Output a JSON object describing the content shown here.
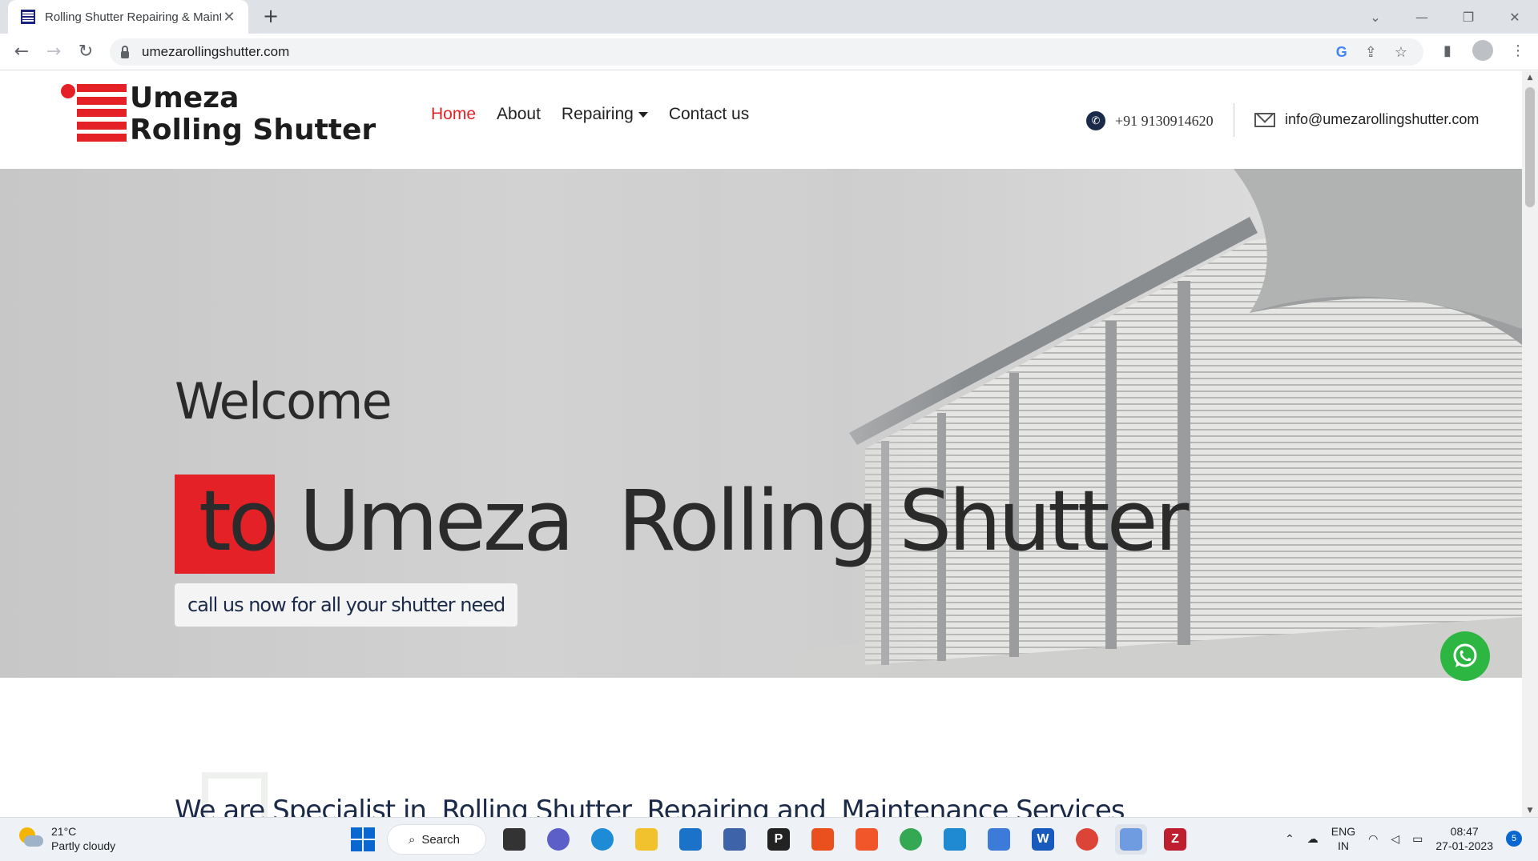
{
  "browser": {
    "tab_title": "Rolling Shutter Repairing & Maintenance",
    "tab_close": "✕",
    "new_tab": "+",
    "url": "umezarollingshutter.com"
  },
  "site": {
    "logo_line1": "Umeza",
    "logo_line2": "Rolling Shutter",
    "nav": [
      {
        "label": "Home",
        "active": true
      },
      {
        "label": "About"
      },
      {
        "label": "Repairing"
      },
      {
        "label": "Contact us"
      }
    ],
    "phone": "+91 9130914620",
    "email": "info@umezarollingshutter.com"
  },
  "hero": {
    "welcome": "Welcome",
    "headline": "to Umeza  Rolling Shutter",
    "cta": "call us now for all your shutter need"
  },
  "section": {
    "title": "We are Specialist in  Rolling Shutter  Repairing and  Maintenance Services"
  },
  "taskbar": {
    "temp": "21°C",
    "weather": "Partly cloudy",
    "search": "Search",
    "lang1": "ENG",
    "lang2": "IN",
    "time": "08:47",
    "date": "27-01-2023",
    "notifications": "5"
  },
  "colors": {
    "brand_red": "#e42127",
    "navy": "#1b2a48",
    "whatsapp": "#2db742"
  }
}
